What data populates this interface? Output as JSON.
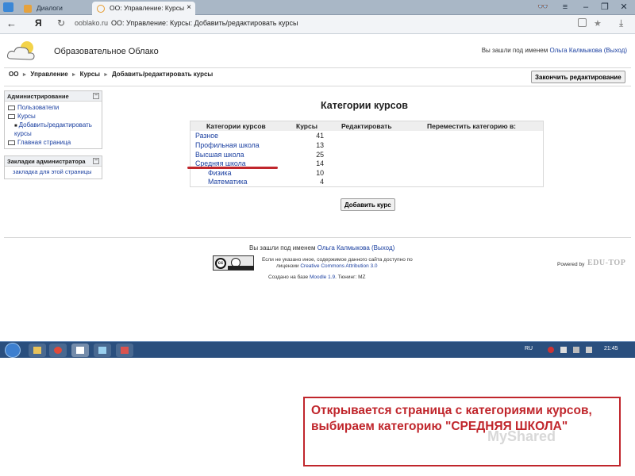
{
  "browser": {
    "tabs": [
      {
        "label": "Диалоги"
      },
      {
        "label": "ОО: Управление: Курсы"
      }
    ],
    "brand_letter": "Я",
    "url_domain": "ooblako.ru",
    "url_title": "ОО: Управление: Курсы: Добавить/редактировать курсы"
  },
  "header": {
    "site_name": "Образовательное Облако",
    "login_prefix": "Вы зашли под именем",
    "user_name": "Ольга Калмыкова",
    "logout": "(Выход)"
  },
  "breadcrumb": {
    "items": [
      "ОО",
      "Управление",
      "Курсы",
      "Добавить/редактировать курсы"
    ],
    "finish_button": "Закончить редактирование"
  },
  "admin_block": {
    "title": "Администрирование",
    "items": [
      "Пользователи",
      "Курсы",
      "Добавить/редактировать курсы",
      "Главная страница"
    ]
  },
  "bookmarks_block": {
    "title": "Закладки администратора",
    "link": "закладка для этой страницы"
  },
  "categories": {
    "page_title": "Категории курсов",
    "headers": [
      "Категории курсов",
      "Курсы",
      "Редактировать",
      "Переместить категорию в:"
    ],
    "rows": [
      {
        "name": "Разное",
        "count": "41"
      },
      {
        "name": "Профильная школа",
        "count": "13"
      },
      {
        "name": "Высшая школа",
        "count": "25"
      },
      {
        "name": "Средняя школа",
        "count": "14"
      },
      {
        "name": "Физика",
        "count": "10"
      },
      {
        "name": "Математика",
        "count": "4"
      }
    ],
    "add_button": "Добавить курс"
  },
  "footer": {
    "login_prefix": "Вы зашли под именем",
    "user_name": "Ольга Калмыкова",
    "logout": "(Выход)",
    "cc_label": "cc",
    "license_line_1": "Если не указано иное, содержимое данного сайта доступно по",
    "license_line_2_prefix": "лицензии",
    "license_link": "Creative Commons Attribution 3.0",
    "based_on": "Создано на базе",
    "based_on_link": "Moodle 1.9",
    "based_on_suffix": ". Тюнинг: MZ",
    "powered": "Powered by",
    "edutop": "EDU-TOP"
  },
  "taskbar": {
    "lang": "RU",
    "clock": "21:45"
  },
  "annotation": {
    "text": "Открывается страница с категориями курсов, выбираем категорию \"СРЕДНЯЯ ШКОЛА\""
  },
  "watermark": "MyShared",
  "colors": {
    "link": "#1a3fa0",
    "annotation": "#c0262c",
    "taskbar": "#2a4f7e"
  }
}
